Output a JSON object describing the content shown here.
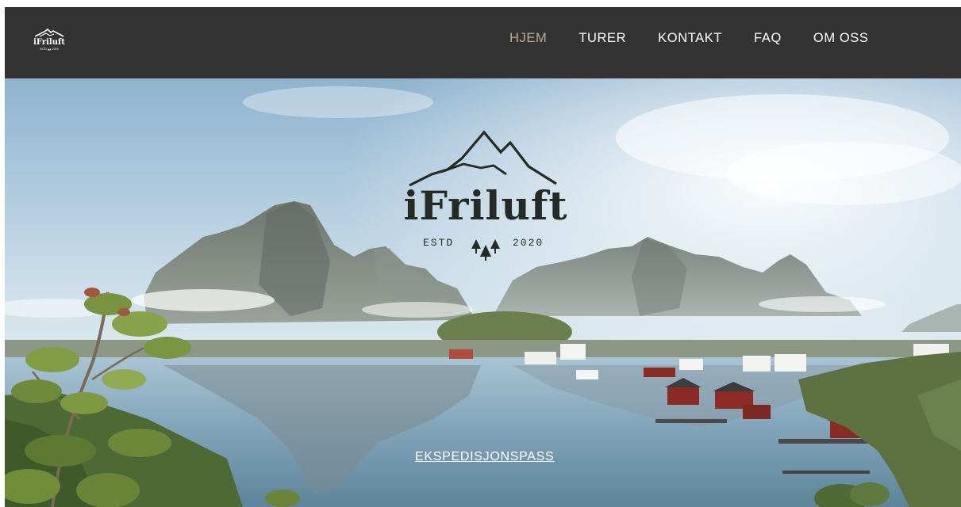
{
  "header": {
    "logo_text": "iFriluft",
    "nav": [
      {
        "label": "HJEM",
        "active": true
      },
      {
        "label": "TURER",
        "active": false
      },
      {
        "label": "KONTAKT",
        "active": false
      },
      {
        "label": "FAQ",
        "active": false
      },
      {
        "label": "OM OSS",
        "active": false
      }
    ]
  },
  "hero": {
    "brand": "iFriluft",
    "estd_label": "ESTD",
    "year": "2020",
    "cta_label": "EKSPEDISJONSPASS"
  },
  "colors": {
    "nav_background": "#333333",
    "nav_active": "#c2aa8e",
    "brand_dark": "#262a26"
  },
  "icons": {
    "logo": "mountain-logo-icon",
    "trees": "pine-trees-icon"
  }
}
